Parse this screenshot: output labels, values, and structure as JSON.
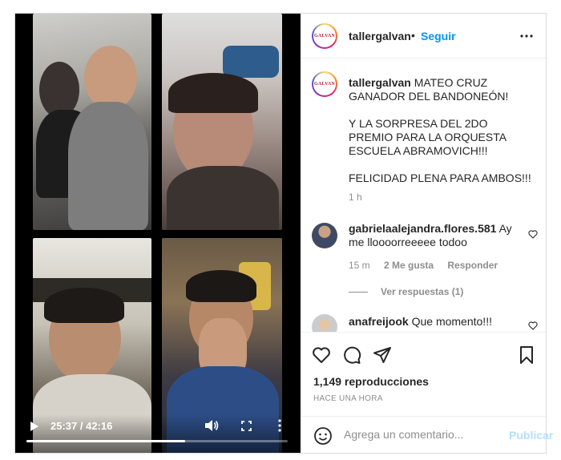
{
  "video": {
    "current_time": "25:37",
    "duration": "42:16",
    "time_separator": " / ",
    "progress": 0.606,
    "icons": [
      "play-icon",
      "volume-icon",
      "fullscreen-icon",
      "more-vertical-icon"
    ]
  },
  "header": {
    "avatar_text": "GALVAN",
    "username": "tallergalvan",
    "separator": "•",
    "follow_label": "Seguir"
  },
  "caption": {
    "username": "tallergalvan",
    "line1": "MATEO CRUZ GANADOR DEL BANDONEÓN!",
    "line2": "Y LA SORPRESA DEL 2DO PREMIO PARA LA ORQUESTA ESCUELA ABRAMOVICH!!!",
    "line3": "FELICIDAD PLENA PARA AMBOS!!!",
    "time": "1 h"
  },
  "comments": [
    {
      "username": "gabrielaalejandra.flores.581",
      "text": "Ay me lloooorreeeee todoo",
      "time": "15 m",
      "likes": "2 Me gusta",
      "reply_label": "Responder",
      "view_replies": "Ver respuestas (1)"
    },
    {
      "username": "anafreijook",
      "text": "Que momento!!!"
    }
  ],
  "actions": {
    "views": "1,149 reproducciones",
    "when": "HACE UNA HORA"
  },
  "add_comment": {
    "placeholder": "Agrega un comentario...",
    "post_label": "Publicar"
  },
  "colors": {
    "link_blue": "#0095f6",
    "post_disabled": "#b2dffc",
    "secondary_text": "#8e8e8e"
  }
}
